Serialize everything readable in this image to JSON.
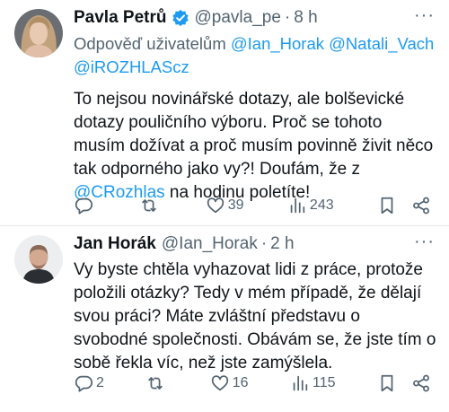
{
  "tweets": [
    {
      "name": "Pavla Petrů",
      "handle": "@pavla_pe",
      "time": "8 h",
      "verified": true,
      "reply_prefix": "Odpověď uživatelům",
      "reply_mentions": [
        "@Ian_Horak",
        "@Natali_Vach",
        "@iROZHLAScz"
      ],
      "body_before": "To nejsou novinářské dotazy, ale bolševické dotazy pouličního výboru. Proč se tohoto musím dožívat a proč musím povinně živit něco tak odporného jako vy?! Doufám, že z ",
      "body_mention": "@CRozhlas",
      "body_after": " na hodinu poletíte!",
      "replies": "",
      "retweets": "",
      "likes": "39",
      "views": "243"
    },
    {
      "name": "Jan Horák",
      "handle": "@Ian_Horak",
      "time": "2 h",
      "body": "Vy byste chtěla vyhazovat lidi z práce, protože položili otázky? Tedy v mém případě, že dělají svou práci? Máte zvláštní představu o svobodné společnosti. Obávám se, že jste tím o sobě řekla víc, než jste zamýšlela.",
      "replies": "2",
      "retweets": "",
      "likes": "16",
      "views": "115"
    }
  ],
  "ui": {
    "separator": "·",
    "more_glyph": "···"
  },
  "colors": {
    "accent": "#1d9bf0",
    "secondary_text": "#536471",
    "divider": "#e6e9ec"
  },
  "icons": [
    "verified-badge-icon",
    "reply-icon",
    "retweet-icon",
    "like-icon",
    "views-icon",
    "bookmark-icon",
    "share-icon"
  ]
}
